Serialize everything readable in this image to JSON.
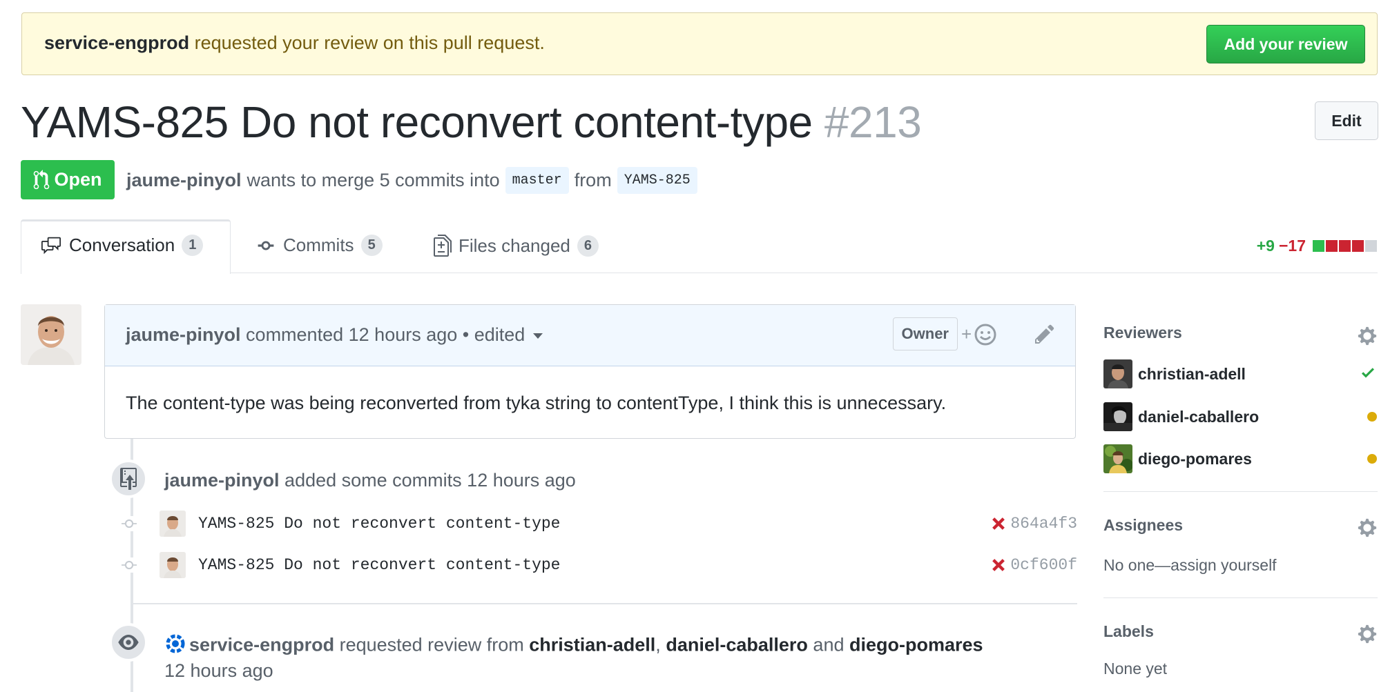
{
  "banner": {
    "requester": "service-engprod",
    "text": " requested your review on this pull request.",
    "button": "Add your review"
  },
  "pr": {
    "title": "YAMS-825 Do not reconvert content-type",
    "number": "#213",
    "edit_label": "Edit",
    "state": "Open",
    "author": "jaume-pinyol",
    "merge_text": "wants to merge 5 commits into",
    "base_branch": "master",
    "from_text": "from",
    "head_branch": "YAMS-825"
  },
  "tabs": [
    {
      "label": "Conversation",
      "count": "1"
    },
    {
      "label": "Commits",
      "count": "5"
    },
    {
      "label": "Files changed",
      "count": "6"
    }
  ],
  "diffstat": {
    "additions": "+9",
    "deletions": "−17",
    "blocks": [
      "#2cbe4e",
      "#cb2431",
      "#cb2431",
      "#cb2431",
      "#d1d5da"
    ]
  },
  "comment": {
    "author": "jaume-pinyol",
    "action": "commented",
    "time": "12 hours ago",
    "edited": "• edited",
    "role": "Owner",
    "body": "The content-type was being reconverted from tyka string to contentType, I think this is unnecessary."
  },
  "timeline": {
    "commits_event": {
      "author": "jaume-pinyol",
      "text": "added some commits",
      "time": "12 hours ago"
    },
    "commits": [
      {
        "message": "YAMS-825 Do not reconvert content-type",
        "sha": "864a4f3"
      },
      {
        "message": "YAMS-825 Do not reconvert content-type",
        "sha": "0cf600f"
      }
    ],
    "review_event": {
      "actor": "service-engprod",
      "text": "requested review from",
      "reviewers": [
        "christian-adell",
        "daniel-caballero",
        "diego-pomares"
      ],
      "comma": ",",
      "and": "and",
      "time": "12 hours ago"
    }
  },
  "sidebar": {
    "reviewers_title": "Reviewers",
    "reviewers": [
      {
        "name": "christian-adell",
        "status": "approved"
      },
      {
        "name": "daniel-caballero",
        "status": "pending"
      },
      {
        "name": "diego-pomares",
        "status": "pending"
      }
    ],
    "assignees_title": "Assignees",
    "assignees_text": "No one—assign yourself",
    "labels_title": "Labels",
    "labels_text": "None yet"
  },
  "colors": {
    "green": "#2cbe4e",
    "red": "#cb2431",
    "pending": "#dbab09"
  }
}
